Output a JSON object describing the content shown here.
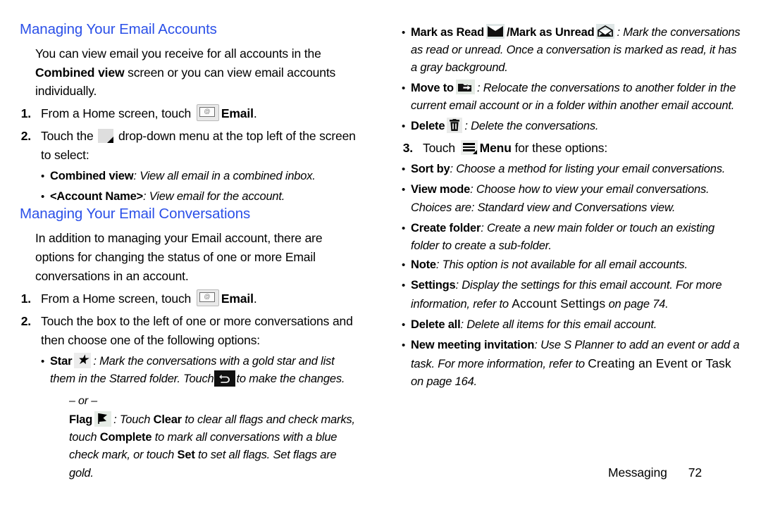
{
  "document": {
    "footer": {
      "section": "Messaging",
      "page_number": "72"
    }
  },
  "left_column": {
    "section1": {
      "title": "Managing Your Email Accounts",
      "intro_part1": "You can view email you receive for all accounts in the ",
      "intro_bold": "Combined view",
      "intro_part2": " screen or you can view email accounts individually.",
      "step1": {
        "number": "1.",
        "text_before": "From a Home screen, touch ",
        "icon": "email-app-icon",
        "label_bold": "Email",
        "text_after": "."
      },
      "step2": {
        "number": "2.",
        "text_before": "Touch the ",
        "icon": "dropdown-icon",
        "text_after": " drop-down menu at the top left of the screen to select:",
        "bullets": [
          {
            "bold": "Combined view",
            "italic": ": View all email in a combined inbox."
          },
          {
            "bold": "<Account Name>",
            "italic": ": View email for the account."
          }
        ]
      }
    },
    "section2": {
      "title": "Managing Your Email Conversations",
      "intro": "In addition to managing your Email account, there are options for changing the status of one or more Email conversations in an account.",
      "step1": {
        "number": "1.",
        "text_before": "From a Home screen, touch ",
        "icon": "email-app-icon",
        "label_bold": "Email",
        "text_after": "."
      },
      "step2": {
        "number": "2.",
        "text": "Touch the box to the left of one or more conversations and then choose one of the following options:",
        "star_bullet": {
          "bold": "Star",
          "icon": "star-icon",
          "text_part1": ": Mark the conversations with a gold star and list them in the Starred folder. Touch",
          "icon2": "back-arrow-icon",
          "text_part2": "to make the changes."
        },
        "or_separator": "– or –",
        "flag_bullet": {
          "bold": "Flag",
          "icon": "flag-icon",
          "seg1": ": Touch ",
          "b1": "Clear",
          "seg2": " to clear all flags and check marks, touch ",
          "b2": "Complete",
          "seg3": " to mark all conversations with a blue check mark, or touch ",
          "b3": "Set",
          "seg4": " to set all flags. Set flags are gold."
        }
      }
    }
  },
  "right_column": {
    "bullets_top": [
      {
        "bold1": "Mark as Read",
        "icon1": "envelope-closed-icon",
        "separator": "/",
        "bold2": "Mark as Unread",
        "icon2": "envelope-open-icon",
        "italic": ": Mark the conversations as read or unread. Once a conversation is marked as read, it has a gray background."
      },
      {
        "bold": "Move to",
        "icon": "move-to-folder-icon",
        "italic": ": Relocate the conversations to another folder in the current email account or in a folder within another email account."
      },
      {
        "bold": "Delete",
        "icon": "trash-icon",
        "italic": ": Delete the conversations."
      }
    ],
    "step3": {
      "number": "3.",
      "text_before": "Touch ",
      "icon": "menu-icon",
      "label_bold": "Menu",
      "text_after": " for these options:"
    },
    "menu_options": [
      {
        "bold": "Sort by",
        "italic": ": Choose a method for listing your email conversations."
      },
      {
        "bold": "View mode",
        "italic": ": Choose how to view your email conversations. Choices are: Standard view and Conversations view."
      },
      {
        "bold": "Create folder",
        "italic": ": Create a new main folder or touch an existing folder to create a sub-folder."
      }
    ],
    "note": {
      "bold": "Note",
      "italic": ": This option is not available for all email accounts."
    },
    "settings_option": {
      "bold": "Settings",
      "italic_part1": ": Display the settings for this email account. For more information, refer to ",
      "xref": "Account Settings",
      "italic_part2": " on page 74."
    },
    "delete_all_option": {
      "bold": "Delete all",
      "italic": ": Delete all items for this email account."
    },
    "meeting_option": {
      "bold": "New meeting invitation",
      "italic_part1": ": Use S Planner to add an event or add a task. For more information, refer to ",
      "xref": "Creating an Event or Task",
      "italic_part2": " on page 164."
    }
  }
}
